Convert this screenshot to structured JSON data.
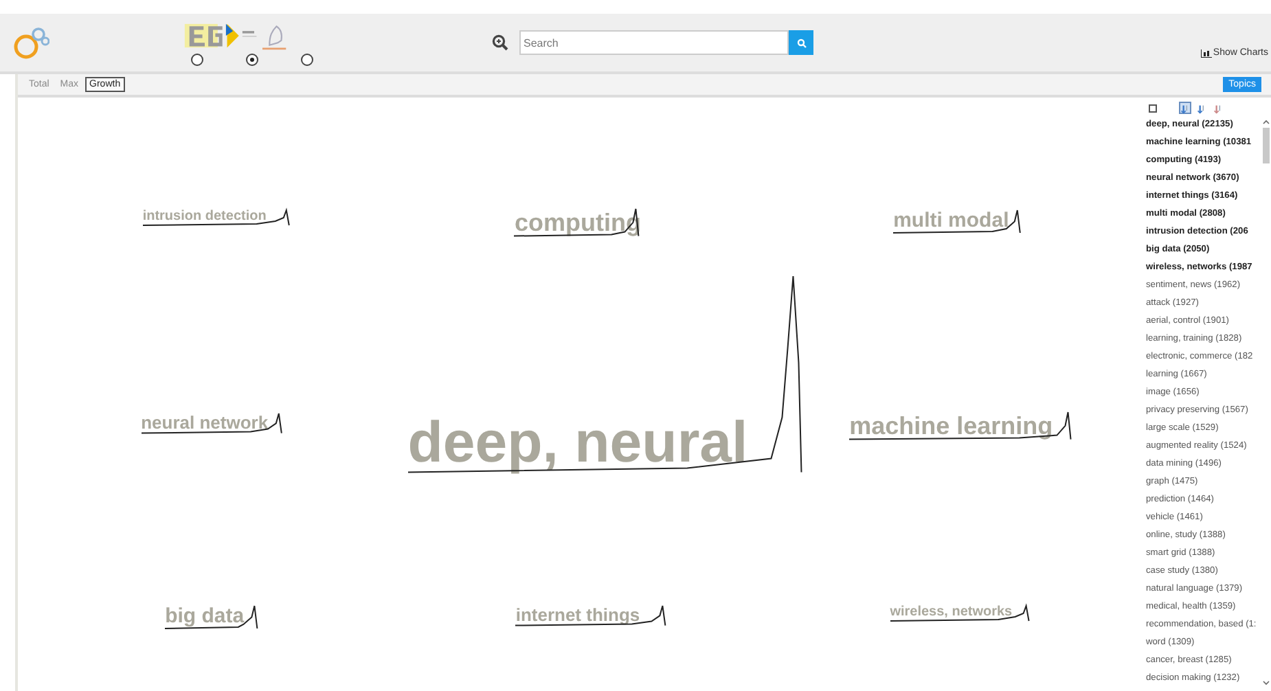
{
  "header": {
    "logo_options": [
      {
        "selected": false
      },
      {
        "selected": true
      },
      {
        "selected": false
      }
    ],
    "search": {
      "placeholder": "Search"
    },
    "show_charts": "Show Charts"
  },
  "modes": [
    {
      "label": "Total",
      "selected": false
    },
    {
      "label": "Max",
      "selected": false
    },
    {
      "label": "Growth",
      "selected": true
    }
  ],
  "topics_button": "Topics",
  "sort_options": [
    {
      "selected": true
    },
    {
      "selected": false
    },
    {
      "selected": false
    }
  ],
  "cloud": [
    {
      "word": "intrusion detection",
      "kind": "tiny"
    },
    {
      "word": "computing",
      "kind": "large"
    },
    {
      "word": "multi modal",
      "kind": "medium"
    },
    {
      "word": "neural network",
      "kind": "small"
    },
    {
      "word": "deep, neural",
      "kind": "huge"
    },
    {
      "word": "machine learning",
      "kind": "large"
    },
    {
      "word": "big data",
      "kind": "medium"
    },
    {
      "word": "internet things",
      "kind": "small"
    },
    {
      "word": "wireless, networks",
      "kind": "tiny"
    }
  ],
  "topics": [
    {
      "label": "deep, neural (22135)",
      "bold": true
    },
    {
      "label": "machine learning (10381",
      "bold": true
    },
    {
      "label": "computing (4193)",
      "bold": true
    },
    {
      "label": "neural network (3670)",
      "bold": true
    },
    {
      "label": "internet things (3164)",
      "bold": true
    },
    {
      "label": "multi modal (2808)",
      "bold": true
    },
    {
      "label": "intrusion detection (206",
      "bold": true
    },
    {
      "label": "big data (2050)",
      "bold": true
    },
    {
      "label": "wireless, networks (1987",
      "bold": true
    },
    {
      "label": "sentiment, news (1962)",
      "bold": false
    },
    {
      "label": "attack (1927)",
      "bold": false
    },
    {
      "label": "aerial, control (1901)",
      "bold": false
    },
    {
      "label": "learning, training (1828)",
      "bold": false
    },
    {
      "label": "electronic, commerce (182",
      "bold": false
    },
    {
      "label": "learning (1667)",
      "bold": false
    },
    {
      "label": "image (1656)",
      "bold": false
    },
    {
      "label": "privacy preserving (1567)",
      "bold": false
    },
    {
      "label": "large scale (1529)",
      "bold": false
    },
    {
      "label": "augmented reality (1524)",
      "bold": false
    },
    {
      "label": "data mining (1496)",
      "bold": false
    },
    {
      "label": "graph (1475)",
      "bold": false
    },
    {
      "label": "prediction (1464)",
      "bold": false
    },
    {
      "label": "vehicle (1461)",
      "bold": false
    },
    {
      "label": "online, study (1388)",
      "bold": false
    },
    {
      "label": "smart grid (1388)",
      "bold": false
    },
    {
      "label": "case study (1380)",
      "bold": false
    },
    {
      "label": "natural language (1379)",
      "bold": false
    },
    {
      "label": "medical, health (1359)",
      "bold": false
    },
    {
      "label": "recommendation, based (1:",
      "bold": false
    },
    {
      "label": "word (1309)",
      "bold": false
    },
    {
      "label": "cancer, breast (1285)",
      "bold": false
    },
    {
      "label": "decision making (1232)",
      "bold": false
    }
  ]
}
